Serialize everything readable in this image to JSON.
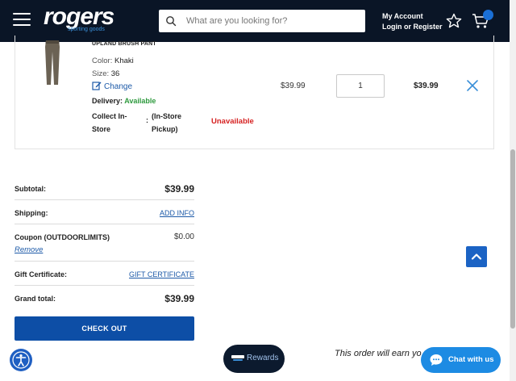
{
  "header": {
    "logo_text": "rogers",
    "logo_sub": "sporting goods",
    "search_placeholder": "What are you looking for?",
    "account_title": "My Account",
    "account_links": "Login or Register"
  },
  "cart_item": {
    "name": "UPLAND BRUSH PANT",
    "color_label": "Color:",
    "color_value": "Khaki",
    "size_label": "Size:",
    "size_value": "36",
    "change_label": "Change",
    "delivery_label": "Delivery:",
    "delivery_value": "Available",
    "collect_label": "Collect In-Store",
    "collect_colon": ":",
    "collect_type": "(In-Store Pickup)",
    "collect_status": "Unavailable",
    "price": "$39.99",
    "quantity": "1",
    "total": "$39.99"
  },
  "summary": {
    "subtotal_label": "Subtotal:",
    "subtotal_value": "$39.99",
    "shipping_label": "Shipping:",
    "shipping_link": "ADD INFO",
    "coupon_label": "Coupon (OUTDOORLIMITS)",
    "coupon_value": "$0.00",
    "coupon_remove": "Remove",
    "gift_label": "Gift Certificate:",
    "gift_link": "GIFT CERTIFICATE",
    "grand_label": "Grand total:",
    "grand_value": "$39.99",
    "checkout_label": "CHECK OUT"
  },
  "footer": {
    "earn_text": "This order will earn yo",
    "rewards_label": "Rewards",
    "chat_label": "Chat with us"
  },
  "colors": {
    "header_bg": "#0a1526",
    "checkout_bg": "#0d4ea6",
    "available": "#2e9a3e",
    "unavailable": "#d62222",
    "link": "#1d5aa8",
    "chat_bg": "#1d8be3"
  }
}
